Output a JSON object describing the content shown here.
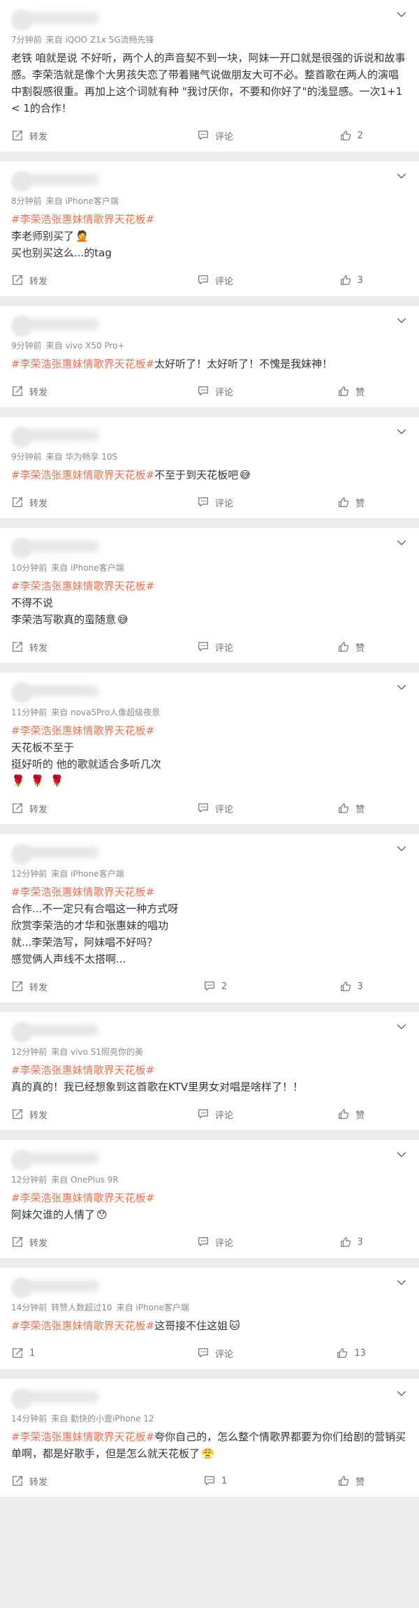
{
  "comments": [
    {
      "meta": [
        "7分钟前",
        "来自 iQOO Z1x 5G流畅先锋"
      ],
      "lines": [
        [
          {
            "t": "老铁 咱就是说 不好听，两个人的声音契不到一块，阿妹一开口就是很强的诉说和故事感。李荣浩就是像个大男孩失恋了带着赌气说做朋友大可不必。整首歌在两人的演唱中割裂感很重。再加上这个词就有种 \"我讨厌你，不要和你好了\"的浅显感。一次1+1 < 1的合作！"
          }
        ]
      ],
      "repost": "转发",
      "comment": "评论",
      "like": "2"
    },
    {
      "meta": [
        "8分钟前",
        "来自 iPhone客户端"
      ],
      "lines": [
        [
          {
            "topic": "#李荣浩张惠妹情歌界天花板#"
          }
        ],
        [
          {
            "t": "李老师别买了"
          },
          {
            "emoji": "🤦"
          }
        ],
        [
          {
            "t": "买也别买这么...的tag"
          }
        ]
      ],
      "repost": "转发",
      "comment": "评论",
      "like": "3"
    },
    {
      "meta": [
        "9分钟前",
        "来自 vivo X50 Pro+"
      ],
      "lines": [
        [
          {
            "topic": "#李荣浩张惠妹情歌界天花板#"
          },
          {
            "t": "太好听了！太好听了！不愧是我妹神！"
          }
        ]
      ],
      "repost": "转发",
      "comment": "评论",
      "like": "赞"
    },
    {
      "meta": [
        "9分钟前",
        "来自 华为畅享 10S"
      ],
      "lines": [
        [
          {
            "topic": "#李荣浩张惠妹情歌界天花板#"
          },
          {
            "t": "不至于到天花板吧"
          },
          {
            "emoji": "😅"
          }
        ]
      ],
      "repost": "转发",
      "comment": "评论",
      "like": "赞"
    },
    {
      "meta": [
        "10分钟前",
        "来自 iPhone客户端"
      ],
      "lines": [
        [
          {
            "topic": "#李荣浩张惠妹情歌界天花板#"
          }
        ],
        [
          {
            "t": "不得不说"
          }
        ],
        [
          {
            "t": "李荣浩写歌真的蛮随意"
          },
          {
            "emoji": "😅"
          }
        ]
      ],
      "repost": "转发",
      "comment": "评论",
      "like": "赞"
    },
    {
      "meta": [
        "11分钟前",
        "来自 nova5Pro人像超级夜景"
      ],
      "lines": [
        [
          {
            "topic": "#李荣浩张惠妹情歌界天花板#"
          }
        ],
        [
          {
            "t": "天花板不至于"
          }
        ],
        [
          {
            "t": "挺好听的 他的歌就适合多听几次"
          }
        ],
        [
          {
            "roses": "🌹🌹🌹"
          }
        ]
      ],
      "repost": "转发",
      "comment": "评论",
      "like": "赞"
    },
    {
      "meta": [
        "12分钟前",
        "来自 iPhone客户端"
      ],
      "lines": [
        [
          {
            "topic": "#李荣浩张惠妹情歌界天花板#"
          }
        ],
        [
          {
            "t": "合作...不一定只有合唱这一种方式呀"
          }
        ],
        [
          {
            "t": "欣赏李荣浩的才华和张惠妹的唱功"
          }
        ],
        [
          {
            "t": "就...李荣浩写，阿妹唱不好吗？"
          }
        ],
        [
          {
            "t": "感觉俩人声线不太搭啊..."
          }
        ]
      ],
      "repost": "转发",
      "comment": "2",
      "like": "3"
    },
    {
      "meta": [
        "12分钟前",
        "来自 vivo S1照亮你的美"
      ],
      "lines": [
        [
          {
            "topic": "#李荣浩张惠妹情歌界天花板#"
          }
        ],
        [
          {
            "t": "真的真的！我已经想象到这首歌在KTV里男女对唱是啥样了！！"
          }
        ]
      ],
      "repost": "转发",
      "comment": "评论",
      "like": "赞"
    },
    {
      "meta": [
        "12分钟前",
        "来自 OnePlus 9R"
      ],
      "lines": [
        [
          {
            "topic": "#李荣浩张惠妹情歌界天花板#"
          }
        ],
        [
          {
            "t": "阿妹欠谁的人情了"
          },
          {
            "emoji": "😯"
          }
        ]
      ],
      "repost": "转发",
      "comment": "评论",
      "like": "3"
    },
    {
      "meta": [
        "14分钟前",
        "转赞人数超过10",
        "来自 iPhone客户端"
      ],
      "lines": [
        [
          {
            "topic": "#李荣浩张惠妹情歌界天花板#"
          },
          {
            "t": "这哥接不住这姐"
          },
          {
            "emoji": "🐱"
          }
        ]
      ],
      "repost": "1",
      "comment": "评论",
      "like": "13"
    },
    {
      "meta": [
        "14分钟前",
        "来自 勤快的小壹iPhone 12"
      ],
      "lines": [
        [
          {
            "topic": "#李荣浩张惠妹情歌界天花板#"
          },
          {
            "t": "夸你自己的，怎么整个情歌界都要为你们给剧的营销买单啊，都是好歌手，但是怎么就天花板了"
          },
          {
            "emoji": "😤"
          }
        ]
      ],
      "repost": "转发",
      "comment": "1",
      "like": "赞"
    }
  ],
  "icons": {
    "repost": "repost-icon",
    "comment": "comment-icon",
    "like": "like-icon",
    "menu": "chevron-down-icon"
  },
  "colors": {
    "topic": "#eb7350",
    "meta": "#8c8c8c",
    "action": "#6f6f6f",
    "separator": "#ececec"
  }
}
